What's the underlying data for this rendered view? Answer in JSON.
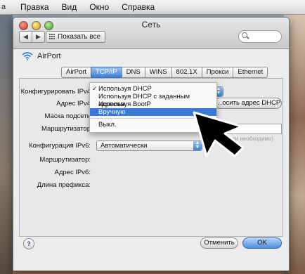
{
  "menubar": {
    "apple": "а",
    "items": [
      "Правка",
      "Вид",
      "Окно",
      "Справка"
    ]
  },
  "window": {
    "title": "Сеть",
    "show_all": "Показать все",
    "back_icon": "◀",
    "forward_icon": "▶"
  },
  "interface": {
    "name": "AirPort"
  },
  "tabs": [
    {
      "label": "AirPort",
      "active": false
    },
    {
      "label": "TCP/IP",
      "active": true
    },
    {
      "label": "DNS",
      "active": false
    },
    {
      "label": "WINS",
      "active": false
    },
    {
      "label": "802.1X",
      "active": false
    },
    {
      "label": "Прокси",
      "active": false
    },
    {
      "label": "Ethernet",
      "active": false
    }
  ],
  "form": {
    "ipv4_label": "Конфигурировать IPv4",
    "ipv4_address_label": "Адрес IPv4",
    "subnet_label": "Маска подсети",
    "router_label": "Маршрутизатор",
    "renew_dhcp_button": "…осить адрес DHCP",
    "if_needed_hint": "(если необходимо)",
    "ipv6_label": "Конфигурация IPv6:",
    "ipv6_value": "Автоматически",
    "router6_label": "Маршрутизатор:",
    "ipv6_address_label": "Адрес IPv6:",
    "prefix_label": "Длина префикса:"
  },
  "ipv4_menu": {
    "items": [
      {
        "label": "Используя DHCP",
        "checked": true,
        "selected": false
      },
      {
        "label": "Используя DHCP с заданным адресом",
        "checked": false,
        "selected": false
      },
      {
        "label": "Используя BootP",
        "checked": false,
        "selected": false
      },
      {
        "label": "Вручную",
        "checked": false,
        "selected": true
      },
      {
        "label": "Выкл.",
        "checked": false,
        "selected": false
      }
    ]
  },
  "footer": {
    "help": "?",
    "cancel": "Отменить",
    "ok": "OK"
  },
  "colors": {
    "accent": "#3a78d8",
    "window_bg": "#ececec"
  }
}
